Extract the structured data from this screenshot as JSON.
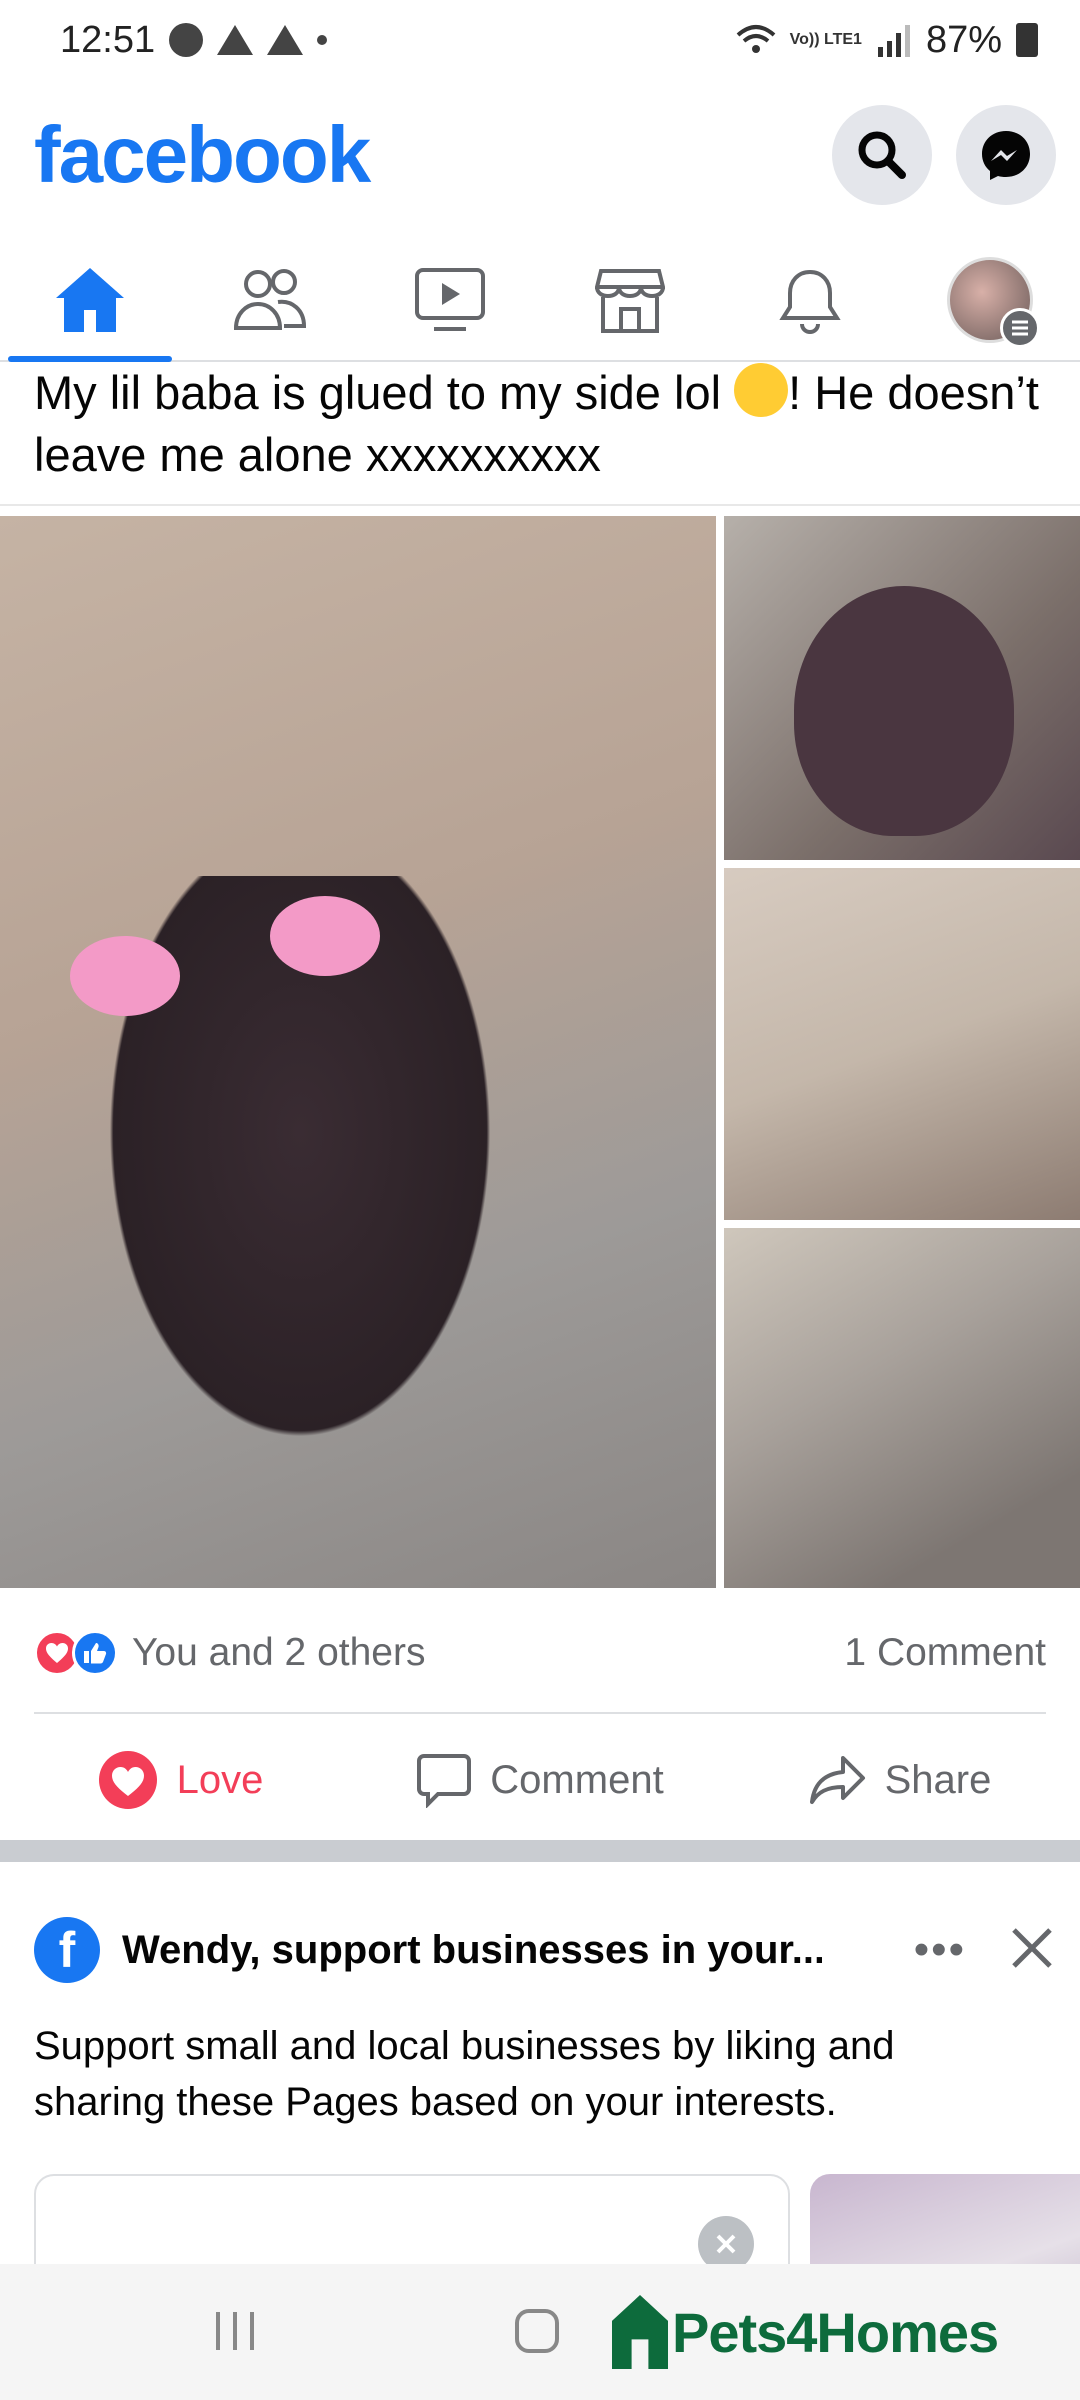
{
  "status_bar": {
    "time": "12:51",
    "battery": "87%",
    "network": "Vo)) LTE1"
  },
  "header": {
    "logo": "facebook",
    "icons": [
      "search-icon",
      "messenger-icon"
    ]
  },
  "nav": {
    "tabs": [
      "home",
      "friends",
      "watch",
      "marketplace",
      "notifications",
      "menu"
    ],
    "active": "home"
  },
  "post": {
    "text_part1": "My lil baba is glued to my side lol ",
    "text_part2": "! He doesn’t leave me alone xxxxxxxxxx",
    "reactions_summary": "You and 2 others",
    "comment_count": "1 Comment",
    "actions": {
      "love": "Love",
      "comment": "Comment",
      "share": "Share"
    }
  },
  "suggestion": {
    "title": "Wendy, support businesses in your...",
    "body": "Support small and local businesses by liking and sharing these Pages based on your interests."
  },
  "overlay": {
    "brand": "Pets4Homes"
  },
  "colors": {
    "brand_blue": "#1877f2",
    "love_red": "#f33e58",
    "muted_gray": "#65676b",
    "pets_green": "#0d6b3c"
  }
}
